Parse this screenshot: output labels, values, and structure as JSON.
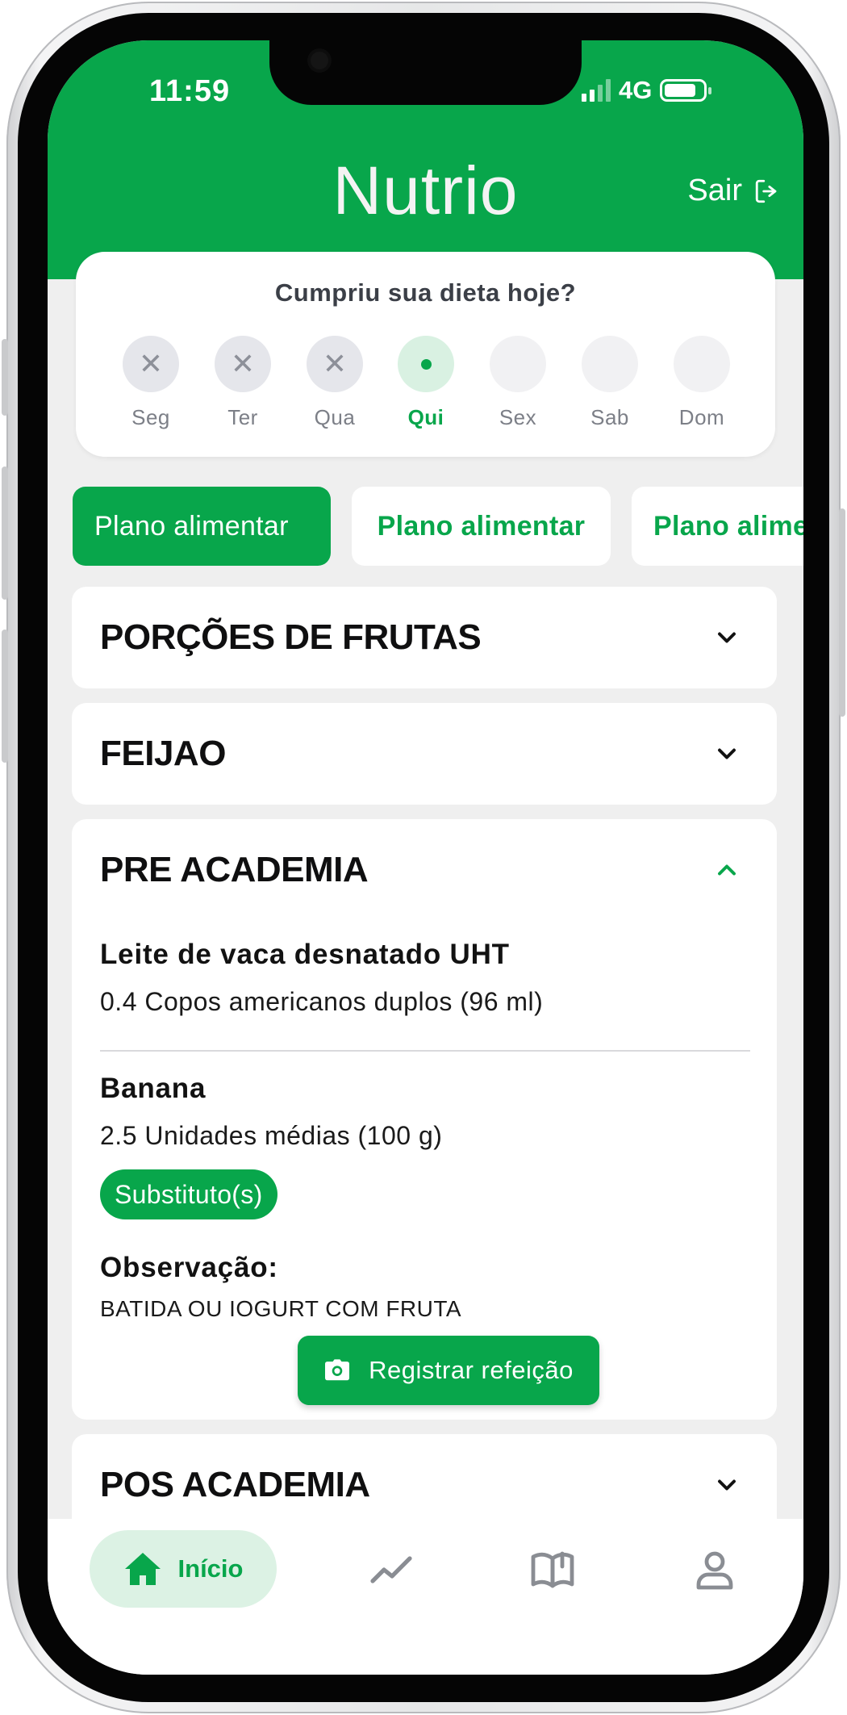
{
  "status_bar": {
    "time": "11:59",
    "network": "4G"
  },
  "header": {
    "app_name": "Nutrio",
    "logout_label": "Sair"
  },
  "tracker": {
    "question": "Cumpriu sua dieta hoje?",
    "days": [
      {
        "label": "Seg",
        "state": "missed"
      },
      {
        "label": "Ter",
        "state": "missed"
      },
      {
        "label": "Qua",
        "state": "missed"
      },
      {
        "label": "Qui",
        "state": "today"
      },
      {
        "label": "Sex",
        "state": "future"
      },
      {
        "label": "Sab",
        "state": "future"
      },
      {
        "label": "Dom",
        "state": "future"
      }
    ]
  },
  "tabs": [
    {
      "label": "Plano alimentar",
      "active": true
    },
    {
      "label": "Plano alimentar",
      "active": false
    },
    {
      "label": "Plano alimentar",
      "active": false
    }
  ],
  "sections": [
    {
      "title": "PORÇÕES DE FRUTAS",
      "expanded": false
    },
    {
      "title": "FEIJAO",
      "expanded": false
    },
    {
      "title": "PRE ACADEMIA",
      "expanded": true,
      "foods": [
        {
          "name": "Leite de vaca desnatado UHT",
          "quantity": "0.4 Copos americanos duplos (96 ml)"
        },
        {
          "name": "Banana",
          "quantity": "2.5 Unidades médias (100 g)",
          "substitutes_label": "Substituto(s)"
        }
      ],
      "observation_label": "Observação:",
      "observation": "BATIDA OU IOGURT COM FRUTA",
      "register_label": "Registrar refeição"
    },
    {
      "title": "POS ACADEMIA",
      "expanded": false
    }
  ],
  "bottom_nav": {
    "home_label": "Início"
  },
  "colors": {
    "brand_green": "#08a64b",
    "light_green": "#dcf2e4",
    "background": "#efefef"
  }
}
